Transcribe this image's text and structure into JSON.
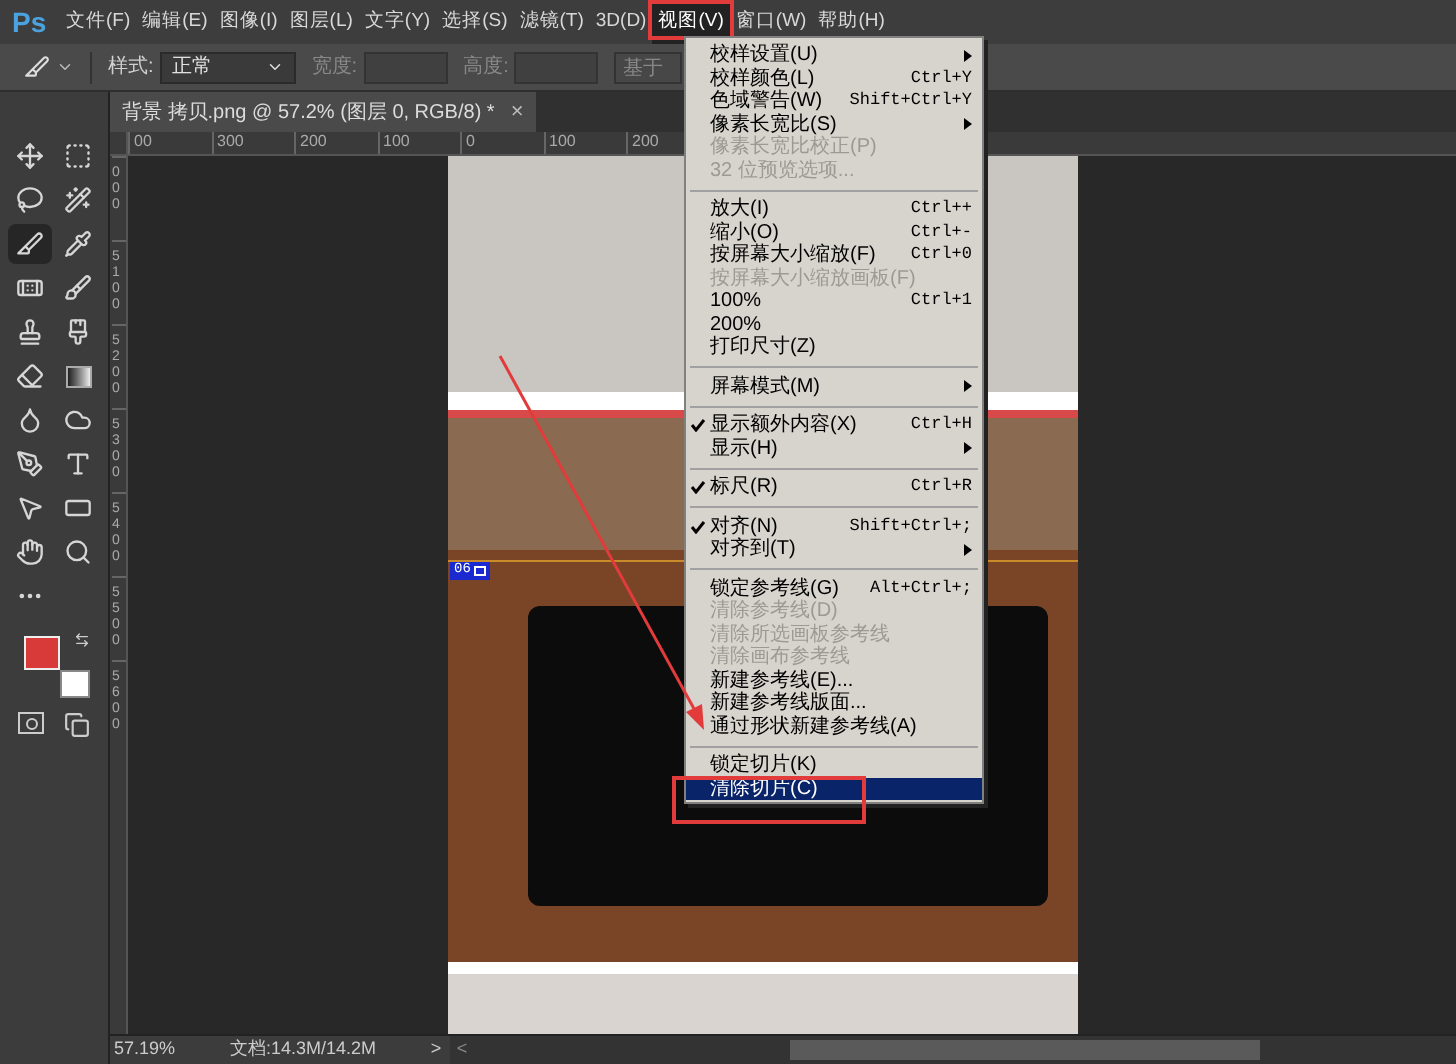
{
  "app_logo": "Ps",
  "menu_bar": [
    {
      "label": "文件(F)",
      "selected": false
    },
    {
      "label": "编辑(E)",
      "selected": false
    },
    {
      "label": "图像(I)",
      "selected": false
    },
    {
      "label": "图层(L)",
      "selected": false
    },
    {
      "label": "文字(Y)",
      "selected": false
    },
    {
      "label": "选择(S)",
      "selected": false
    },
    {
      "label": "滤镜(T)",
      "selected": false
    },
    {
      "label": "3D(D)",
      "selected": false
    },
    {
      "label": "视图(V)",
      "selected": true
    },
    {
      "label": "窗口(W)",
      "selected": false
    },
    {
      "label": "帮助(H)",
      "selected": false
    }
  ],
  "options_bar": {
    "style_label": "样式:",
    "style_value": "正常",
    "width_label": "宽度:",
    "height_label": "高度:",
    "button": "基于"
  },
  "tools": [
    {
      "selected": false
    },
    {
      "selected": false
    },
    {
      "selected": false
    },
    {
      "selected": false
    },
    {
      "selected": true
    },
    {
      "selected": false
    },
    {
      "selected": false
    },
    {
      "selected": false
    },
    {
      "selected": false
    },
    {
      "selected": false
    },
    {
      "selected": false
    },
    {
      "selected": false
    },
    {
      "selected": false
    },
    {
      "selected": false
    },
    {
      "selected": false
    },
    {
      "selected": false
    },
    {
      "selected": false
    },
    {
      "selected": false
    },
    {
      "selected": false
    },
    {
      "selected": false
    },
    {
      "selected": false
    }
  ],
  "color_swatches": [
    {
      "kind": "foreground",
      "color": "#d83a3a"
    },
    {
      "kind": "background",
      "color": "#ffffff"
    }
  ],
  "document_tab": {
    "title": "背景 拷贝.png @ 57.2% (图层 0, RGB/8) *",
    "close": "×"
  },
  "top_ruler": [
    "00",
    "300",
    "200",
    "100",
    "0",
    "100",
    "200"
  ],
  "left_ruler": [
    "000",
    "5100",
    "5200",
    "5300",
    "5400",
    "5500",
    "5600"
  ],
  "slice_label": "06",
  "view_menu": [
    {
      "kind": "item",
      "label": "校样设置(U)",
      "disabled": false,
      "checked": false,
      "submenu": true,
      "selected": false
    },
    {
      "kind": "item",
      "label": "校样颜色(L)",
      "shortcut": "Ctrl+Y",
      "disabled": false,
      "checked": false,
      "submenu": false,
      "selected": false
    },
    {
      "kind": "item",
      "label": "色域警告(W)",
      "shortcut": "Shift+Ctrl+Y",
      "disabled": false,
      "checked": false,
      "submenu": false,
      "selected": false
    },
    {
      "kind": "item",
      "label": "像素长宽比(S)",
      "disabled": false,
      "checked": false,
      "submenu": true,
      "selected": false
    },
    {
      "kind": "item",
      "label": "像素长宽比校正(P)",
      "disabled": true,
      "checked": false,
      "submenu": false,
      "selected": false
    },
    {
      "kind": "item",
      "label": "32 位预览选项...",
      "disabled": true,
      "checked": false,
      "submenu": false,
      "selected": false
    },
    {
      "kind": "separator"
    },
    {
      "kind": "item",
      "label": "放大(I)",
      "shortcut": "Ctrl++",
      "disabled": false,
      "checked": false,
      "submenu": false,
      "selected": false
    },
    {
      "kind": "item",
      "label": "缩小(O)",
      "shortcut": "Ctrl+-",
      "disabled": false,
      "checked": false,
      "submenu": false,
      "selected": false
    },
    {
      "kind": "item",
      "label": "按屏幕大小缩放(F)",
      "shortcut": "Ctrl+0",
      "disabled": false,
      "checked": false,
      "submenu": false,
      "selected": false
    },
    {
      "kind": "item",
      "label": "按屏幕大小缩放画板(F)",
      "disabled": true,
      "checked": false,
      "submenu": false,
      "selected": false
    },
    {
      "kind": "item",
      "label": "100%",
      "shortcut": "Ctrl+1",
      "disabled": false,
      "checked": false,
      "submenu": false,
      "selected": false
    },
    {
      "kind": "item",
      "label": "200%",
      "disabled": false,
      "checked": false,
      "submenu": false,
      "selected": false
    },
    {
      "kind": "item",
      "label": "打印尺寸(Z)",
      "disabled": false,
      "checked": false,
      "submenu": false,
      "selected": false
    },
    {
      "kind": "separator"
    },
    {
      "kind": "item",
      "label": "屏幕模式(M)",
      "disabled": false,
      "checked": false,
      "submenu": true,
      "selected": false
    },
    {
      "kind": "separator"
    },
    {
      "kind": "item",
      "label": "显示额外内容(X)",
      "shortcut": "Ctrl+H",
      "disabled": false,
      "checked": true,
      "submenu": false,
      "selected": false
    },
    {
      "kind": "item",
      "label": "显示(H)",
      "disabled": false,
      "checked": false,
      "submenu": true,
      "selected": false
    },
    {
      "kind": "separator"
    },
    {
      "kind": "item",
      "label": "标尺(R)",
      "shortcut": "Ctrl+R",
      "disabled": false,
      "checked": true,
      "submenu": false,
      "selected": false
    },
    {
      "kind": "separator"
    },
    {
      "kind": "item",
      "label": "对齐(N)",
      "shortcut": "Shift+Ctrl+;",
      "disabled": false,
      "checked": true,
      "submenu": false,
      "selected": false
    },
    {
      "kind": "item",
      "label": "对齐到(T)",
      "disabled": false,
      "checked": false,
      "submenu": true,
      "selected": false
    },
    {
      "kind": "separator"
    },
    {
      "kind": "item",
      "label": "锁定参考线(G)",
      "shortcut": "Alt+Ctrl+;",
      "disabled": false,
      "checked": false,
      "submenu": false,
      "selected": false
    },
    {
      "kind": "item",
      "label": "清除参考线(D)",
      "disabled": true,
      "checked": false,
      "submenu": false,
      "selected": false
    },
    {
      "kind": "item",
      "label": "清除所选画板参考线",
      "disabled": true,
      "checked": false,
      "submenu": false,
      "selected": false
    },
    {
      "kind": "item",
      "label": "清除画布参考线",
      "disabled": true,
      "checked": false,
      "submenu": false,
      "selected": false
    },
    {
      "kind": "item",
      "label": "新建参考线(E)...",
      "disabled": false,
      "checked": false,
      "submenu": false,
      "selected": false
    },
    {
      "kind": "item",
      "label": "新建参考线版面...",
      "disabled": false,
      "checked": false,
      "submenu": false,
      "selected": false
    },
    {
      "kind": "item",
      "label": "通过形状新建参考线(A)",
      "disabled": false,
      "checked": false,
      "submenu": false,
      "selected": false
    },
    {
      "kind": "separator"
    },
    {
      "kind": "item",
      "label": "锁定切片(K)",
      "disabled": false,
      "checked": false,
      "submenu": false,
      "selected": false
    },
    {
      "kind": "item",
      "label": "清除切片(C)",
      "disabled": false,
      "checked": false,
      "submenu": false,
      "selected": true
    }
  ],
  "status_bar": {
    "zoom": "57.19%",
    "document": "文档:14.3M/14.2M",
    "next": ">",
    "scroll_left": "<"
  }
}
